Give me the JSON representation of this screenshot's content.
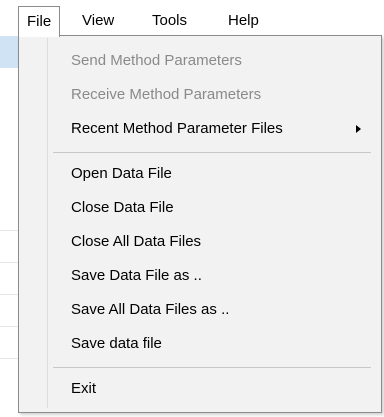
{
  "menubar": {
    "items": [
      {
        "label": "File"
      },
      {
        "label": "View"
      },
      {
        "label": "Tools"
      },
      {
        "label": "Help"
      }
    ]
  },
  "file_menu": {
    "send_method_parameters": "Send Method Parameters",
    "receive_method_parameters": "Receive Method Parameters",
    "recent_method_parameter_files": "Recent Method Parameter Files",
    "open_data_file": "Open Data File",
    "close_data_file": "Close Data File",
    "close_all_data_files": "Close All Data Files",
    "save_data_file_as": "Save Data File as ..",
    "save_all_data_files_as": "Save All Data Files as ..",
    "save_data_file": "Save data file",
    "exit": "Exit"
  },
  "icons": {
    "submenu_arrow": "chevron-right-icon"
  },
  "colors": {
    "menu_background": "#f2f2f2",
    "disabled_text": "#8a8a8a",
    "border": "#8c8c8c",
    "underlying_highlight": "#cfe3f5"
  }
}
